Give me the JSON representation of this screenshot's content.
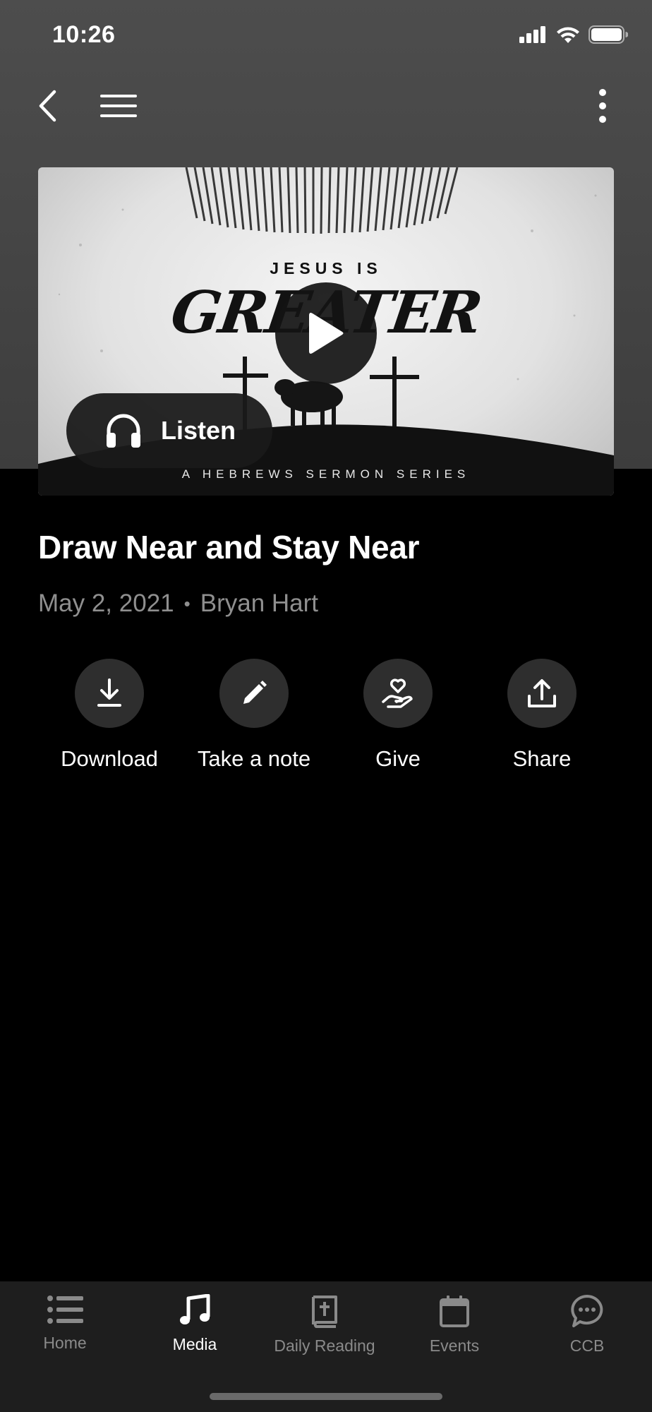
{
  "status_bar": {
    "time": "10:26"
  },
  "hero": {
    "top_text": "JESUS IS",
    "big_text": "GREATER",
    "bottom_text": "A HEBREWS SERMON SERIES",
    "listen_label": "Listen"
  },
  "sermon": {
    "title": "Draw Near and Stay Near",
    "date": "May 2, 2021",
    "separator": "•",
    "speaker": "Bryan Hart"
  },
  "actions": [
    {
      "label": "Download",
      "icon": "download-icon"
    },
    {
      "label": "Take a note",
      "icon": "pencil-icon"
    },
    {
      "label": "Give",
      "icon": "give-heart-hand-icon"
    },
    {
      "label": "Share",
      "icon": "share-icon"
    }
  ],
  "tabs": [
    {
      "label": "Home",
      "icon": "list-icon",
      "active": false
    },
    {
      "label": "Media",
      "icon": "music-note-icon",
      "active": true
    },
    {
      "label": "Daily Reading",
      "icon": "bible-icon",
      "active": false
    },
    {
      "label": "Events",
      "icon": "calendar-icon",
      "active": false
    },
    {
      "label": "CCB",
      "icon": "chat-bubble-icon",
      "active": false
    }
  ],
  "colors": {
    "background": "#000000",
    "header_gray": "#474747",
    "action_circle": "#2e2e2e",
    "tab_bar": "#1e1e1e",
    "meta_text": "#8f8f8f",
    "inactive_tab": "#8a8a8a"
  }
}
